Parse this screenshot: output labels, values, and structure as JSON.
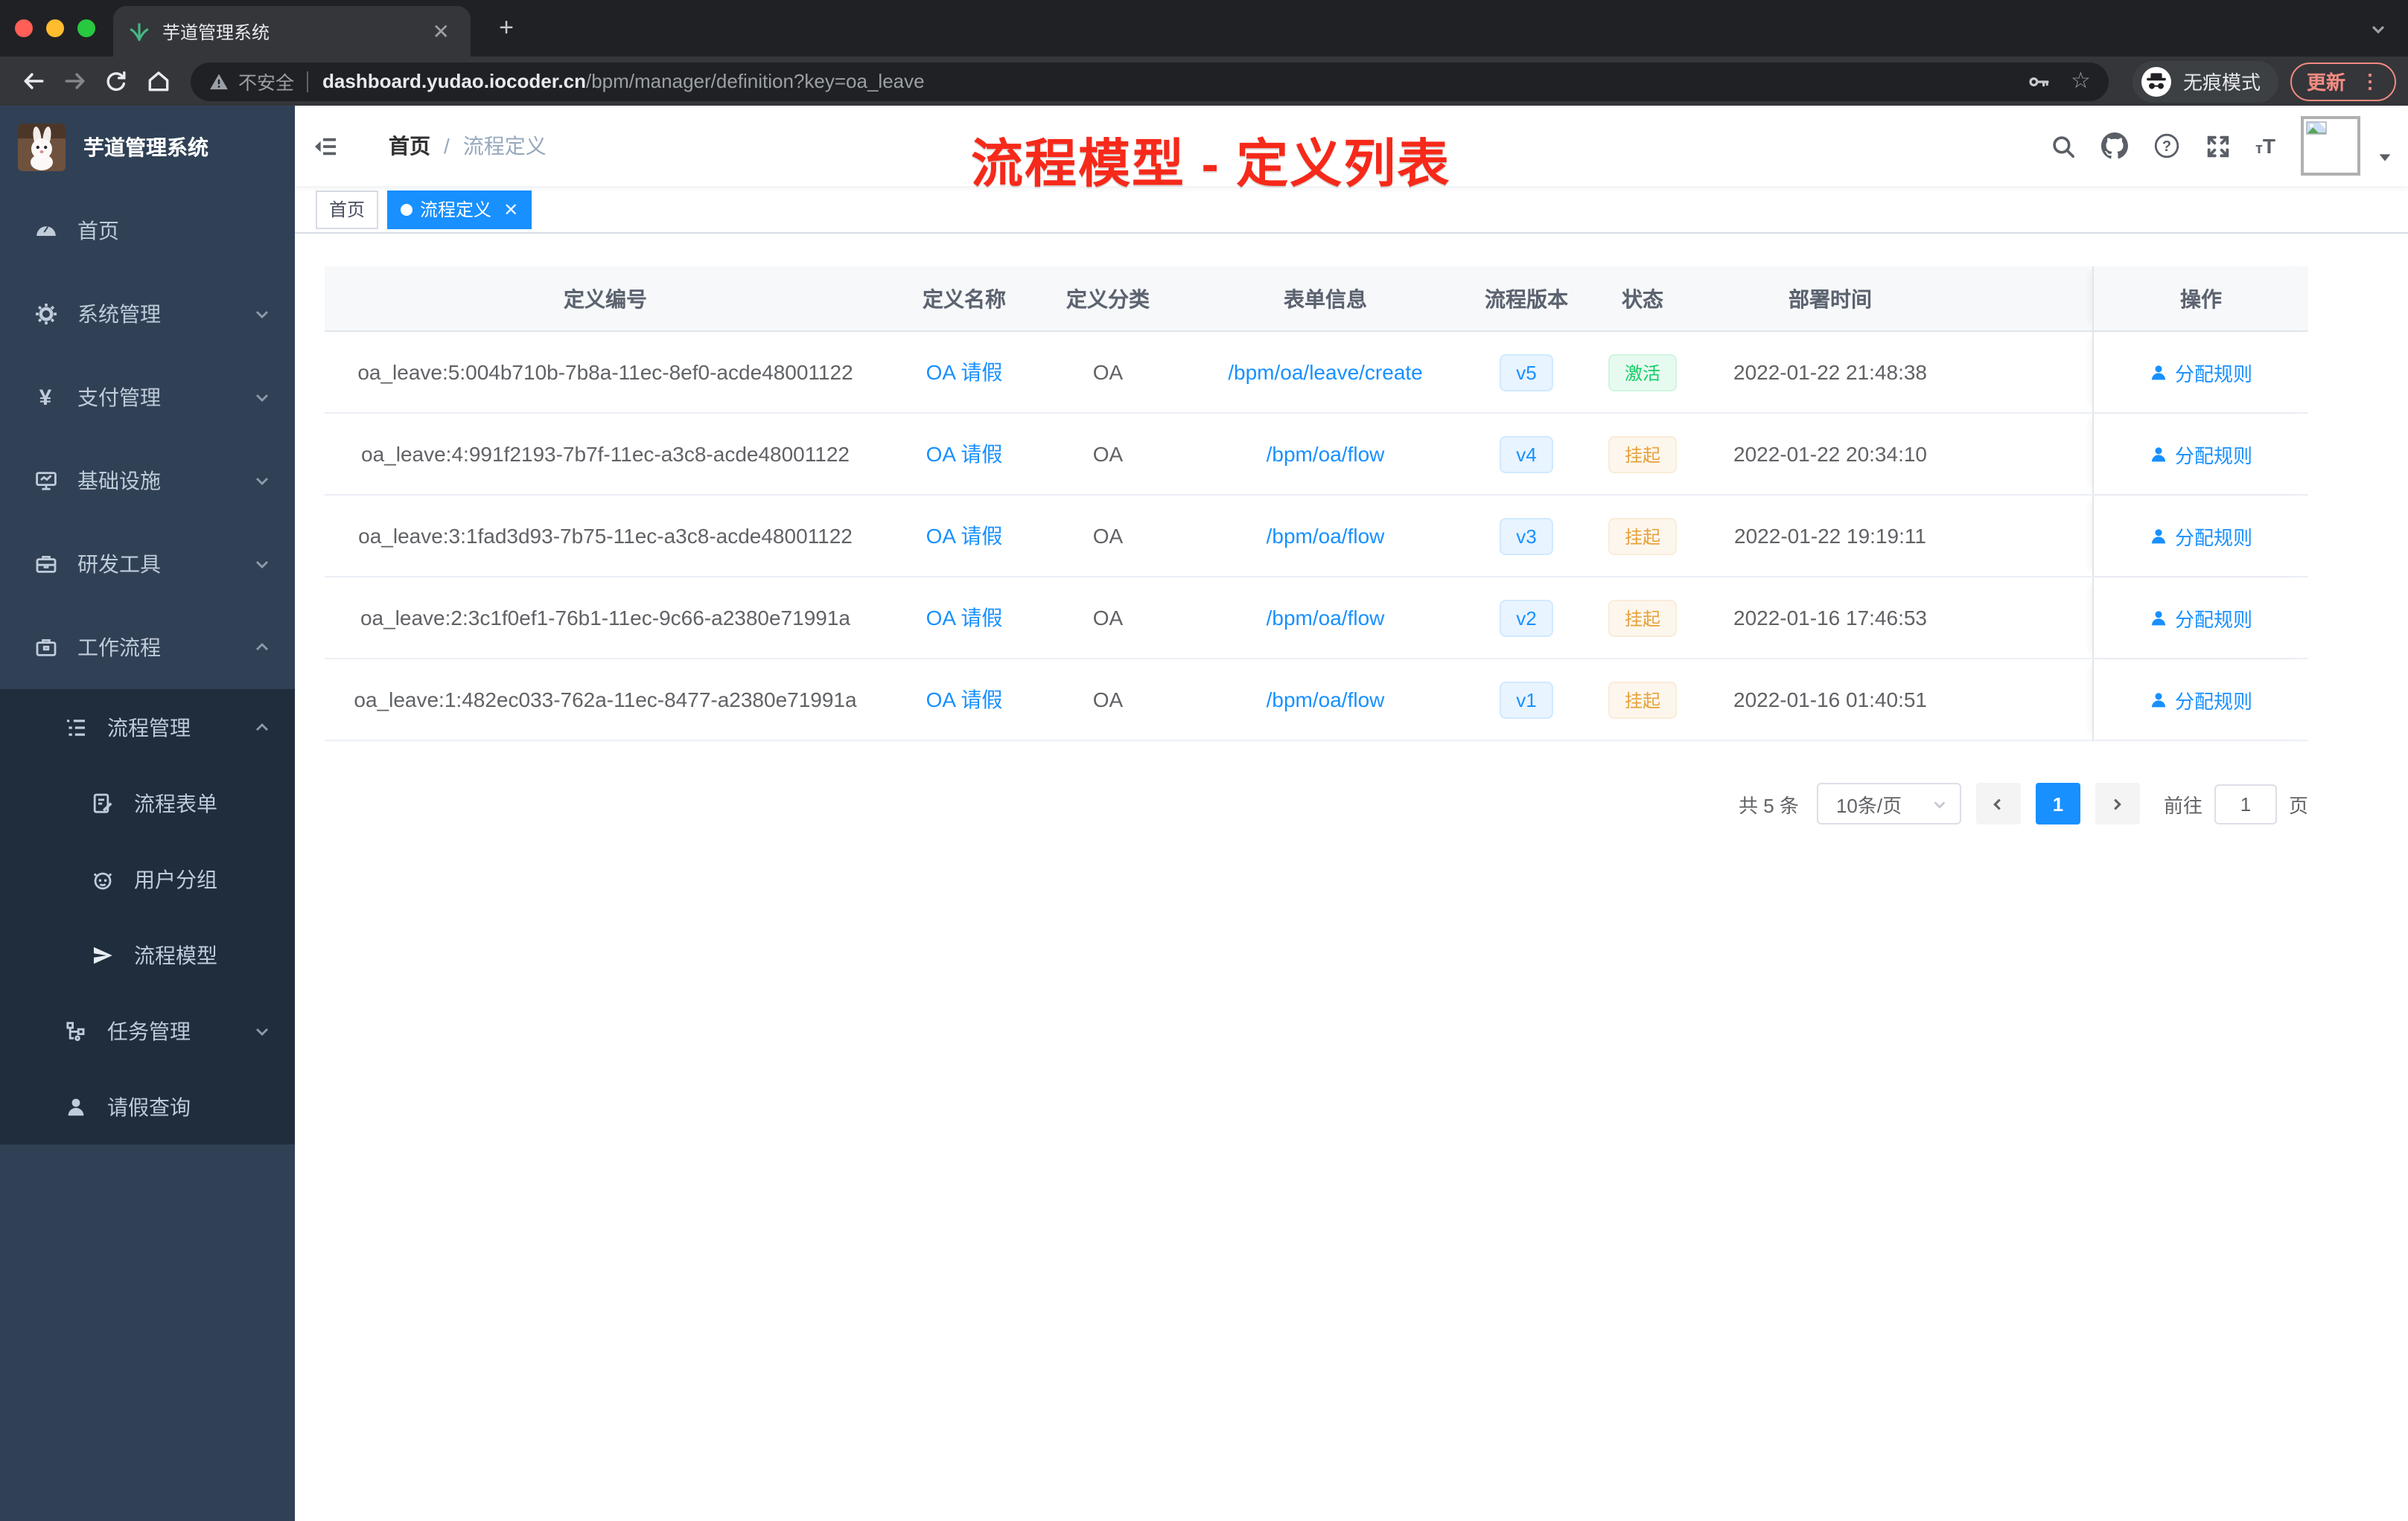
{
  "browser": {
    "tab_title": "芋道管理系统",
    "security_label": "不安全",
    "url_host": "dashboard.yudao.iocoder.cn",
    "url_path": "/bpm/manager/definition?key=oa_leave",
    "incognito_label": "无痕模式",
    "update_label": "更新"
  },
  "sidebar": {
    "app_title": "芋道管理系统",
    "items": [
      {
        "label": "首页",
        "icon": "dashboard-icon"
      },
      {
        "label": "系统管理",
        "icon": "gear-icon"
      },
      {
        "label": "支付管理",
        "icon": "yen-icon"
      },
      {
        "label": "基础设施",
        "icon": "monitor-icon"
      },
      {
        "label": "研发工具",
        "icon": "toolbox-icon"
      },
      {
        "label": "工作流程",
        "icon": "briefcase-icon"
      }
    ],
    "workflow_children": [
      {
        "label": "流程管理",
        "icon": "list-tree-icon"
      },
      {
        "label": "流程表单",
        "icon": "form-doc-icon"
      },
      {
        "label": "用户分组",
        "icon": "robot-icon"
      },
      {
        "label": "流程模型",
        "icon": "paper-plane-icon"
      },
      {
        "label": "任务管理",
        "icon": "org-tree-icon"
      },
      {
        "label": "请假查询",
        "icon": "person-icon"
      }
    ]
  },
  "header": {
    "breadcrumb_home": "首页",
    "breadcrumb_sep": "/",
    "breadcrumb_current": "流程定义",
    "annotation": "流程模型 - 定义列表"
  },
  "tags": {
    "home": "首页",
    "active": "流程定义"
  },
  "table": {
    "columns": {
      "id": "定义编号",
      "name": "定义名称",
      "category": "定义分类",
      "form": "表单信息",
      "version": "流程版本",
      "status": "状态",
      "deploy_time": "部署时间",
      "action": "操作"
    },
    "rows": [
      {
        "id": "oa_leave:5:004b710b-7b8a-11ec-8ef0-acde48001122",
        "name": "OA 请假",
        "category": "OA",
        "form": "/bpm/oa/leave/create",
        "version": "v5",
        "status": "激活",
        "status_type": "success",
        "time": "2022-01-22 21:48:38",
        "action": "分配规则"
      },
      {
        "id": "oa_leave:4:991f2193-7b7f-11ec-a3c8-acde48001122",
        "name": "OA 请假",
        "category": "OA",
        "form": "/bpm/oa/flow",
        "version": "v4",
        "status": "挂起",
        "status_type": "warning",
        "time": "2022-01-22 20:34:10",
        "action": "分配规则"
      },
      {
        "id": "oa_leave:3:1fad3d93-7b75-11ec-a3c8-acde48001122",
        "name": "OA 请假",
        "category": "OA",
        "form": "/bpm/oa/flow",
        "version": "v3",
        "status": "挂起",
        "status_type": "warning",
        "time": "2022-01-22 19:19:11",
        "action": "分配规则"
      },
      {
        "id": "oa_leave:2:3c1f0ef1-76b1-11ec-9c66-a2380e71991a",
        "name": "OA 请假",
        "category": "OA",
        "form": "/bpm/oa/flow",
        "version": "v2",
        "status": "挂起",
        "status_type": "warning",
        "time": "2022-01-16 17:46:53",
        "action": "分配规则"
      },
      {
        "id": "oa_leave:1:482ec033-762a-11ec-8477-a2380e71991a",
        "name": "OA 请假",
        "category": "OA",
        "form": "/bpm/oa/flow",
        "version": "v1",
        "status": "挂起",
        "status_type": "warning",
        "time": "2022-01-16 01:40:51",
        "action": "分配规则"
      }
    ]
  },
  "pagination": {
    "total": "共 5 条",
    "page_size": "10条/页",
    "current_page": "1",
    "goto_prefix": "前往",
    "goto_value": "1",
    "goto_suffix": "页"
  },
  "colors": {
    "accent": "#1890ff",
    "annotation_red": "#f6291a",
    "success": "#13ce66",
    "warning": "#e6a23c",
    "sidebar_bg": "#304156",
    "submenu_bg": "#1f2d3d",
    "tab_bg": "#35363a",
    "chrome_bg": "#202124"
  }
}
